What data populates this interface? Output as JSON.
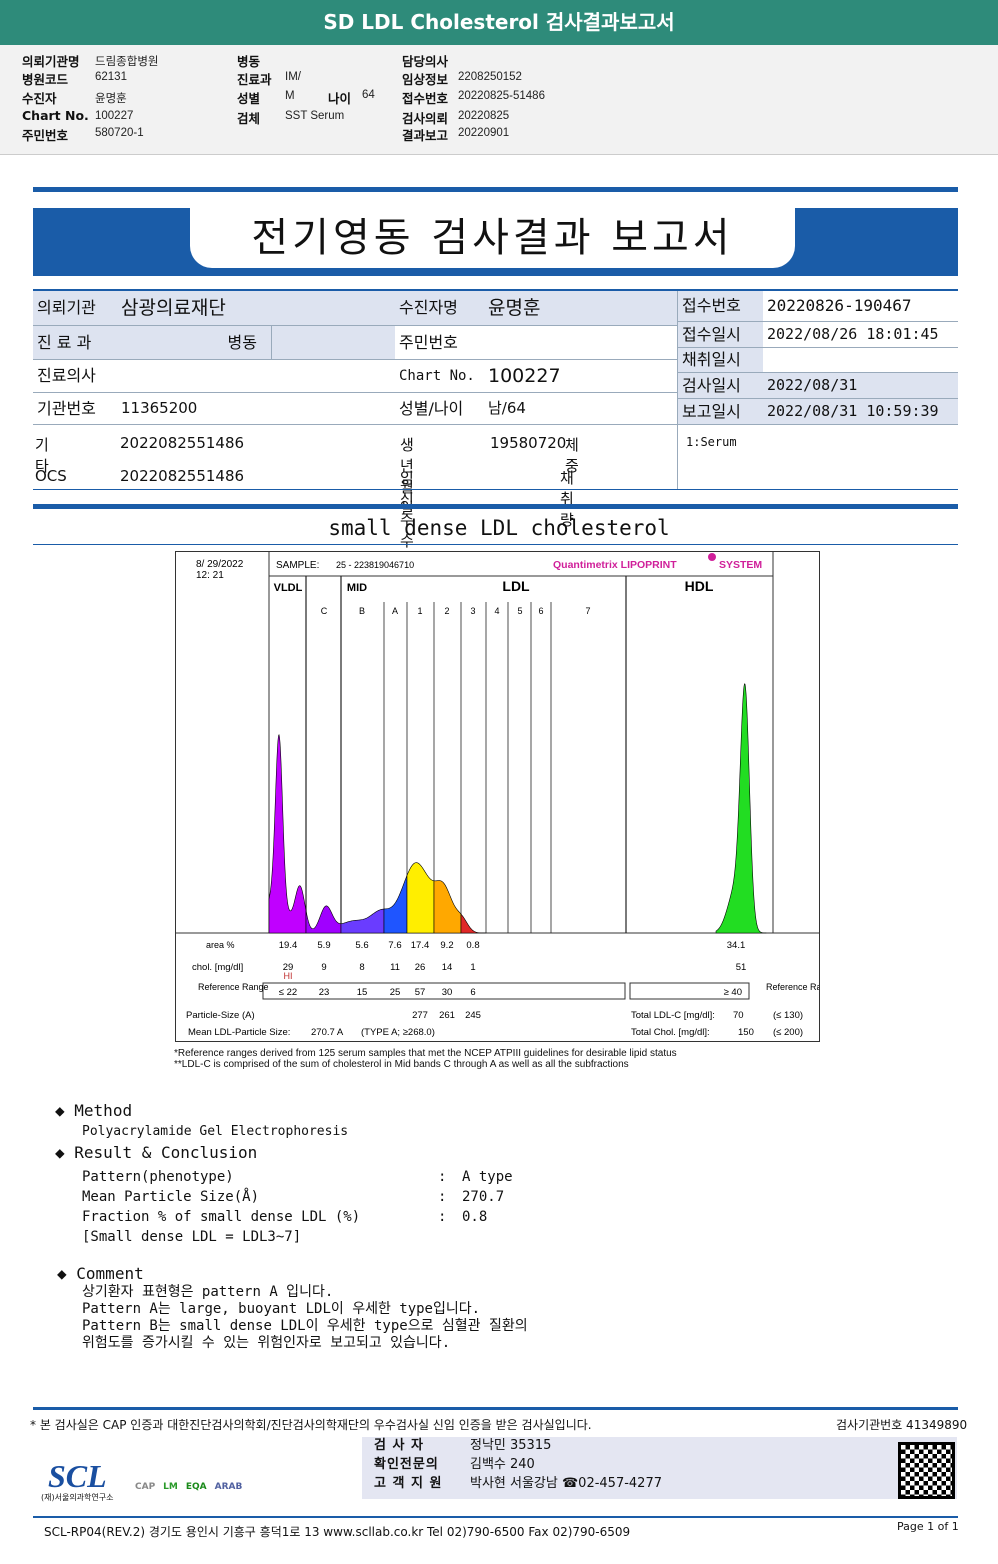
{
  "title": "SD LDL Cholesterol 검사결과보고서",
  "info": {
    "c1": [
      [
        "의뢰기관명",
        "드림종합병원"
      ],
      [
        "병원코드",
        "62131"
      ],
      [
        "수진자",
        "윤명훈"
      ],
      [
        "Chart No.",
        "100227"
      ],
      [
        "주민번호",
        "580720-1"
      ]
    ],
    "c2": [
      [
        "병동",
        ""
      ],
      [
        "진료과",
        "IM/"
      ],
      [
        "성별",
        "M"
      ],
      [
        "검체",
        "SST Serum"
      ]
    ],
    "age_label": "나이",
    "age": "64",
    "c3": [
      [
        "담당의사",
        ""
      ],
      [
        "임상정보",
        "2208250152"
      ],
      [
        "접수번호",
        "20220825-51486"
      ],
      [
        "검사의뢰",
        "20220825"
      ],
      [
        "결과보고",
        "20220901"
      ]
    ]
  },
  "report_title": "전기영동 검사결과 보고서",
  "form": {
    "inst_l": "의뢰기관",
    "inst_v": "삼광의료재단",
    "patient_l": "수진자명",
    "patient_v": "윤명훈",
    "dept_l": "진 료 과",
    "ward_l": "병동",
    "rrn_l": "주민번호",
    "doctor_l": "진료의사",
    "chart_l": "Chart No.",
    "chart_v": "100227",
    "code_l": "기관번호",
    "code_v": "11365200",
    "sexage_l": "성별/나이",
    "sexage_v": "남/64",
    "etc_l": "기타",
    "etc_v": "2022082551486",
    "birth_l": "생년월일",
    "birth_v": "19580720",
    "weight_l": "체중",
    "ocs_l": "OCS",
    "ocs_v": "2022082551486",
    "preg_l": "임신주수",
    "vol_l": "채취량",
    "recno_l": "접수번호",
    "recno_v": "20220826-190467",
    "recdt_l": "접수일시",
    "recdt_v": "2022/08/26 18:01:45",
    "coll_l": "채취일시",
    "test_l": "검사일시",
    "test_v": "2022/08/31",
    "rep_l": "보고일시",
    "rep_v": "2022/08/31 10:59:39",
    "specimen": "1:Serum"
  },
  "section_title": "small dense LDL cholesterol",
  "chart": {
    "date": "8/ 29/2022",
    "time": "12: 21",
    "sample_label": "SAMPLE:",
    "sample": "25 - 223819046710",
    "brand": "Quantimetrix LIPOPRINT",
    "brand2": "SYSTEM",
    "brand_color": "#d0209a",
    "groups": [
      "VLDL",
      "MID",
      "LDL",
      "HDL"
    ],
    "bands": [
      "C",
      "B",
      "A",
      "1",
      "2",
      "3",
      "4",
      "5",
      "6",
      "7"
    ],
    "row_area": "area %",
    "row_chol": "chol. [mg/dl]",
    "ref_label": "Reference Range",
    "ref_label_r": "Reference Range",
    "area": [
      "19.4",
      "5.9",
      "5.6",
      "7.6",
      "17.4",
      "9.2",
      "0.8"
    ],
    "area_hdl": "34.1",
    "chol": [
      "29",
      "9",
      "8",
      "11",
      "26",
      "14",
      "1"
    ],
    "chol_hdl": "51",
    "hi_flag": "HI",
    "ref": [
      "≤ 22",
      "23",
      "15",
      "25",
      "57",
      "30",
      "6"
    ],
    "ref_hdl": "≥ 40",
    "ps_label": "Particle-Size (A)",
    "ps": [
      "277",
      "261",
      "245"
    ],
    "mean_label": "Mean LDL-Particle Size:",
    "mean_v": "270.7 A",
    "mean_type": "(TYPE A; ≥268.0)",
    "tldl_label": "Total LDL-C [mg/dl]:",
    "tldl_v": "70",
    "tldl_ref": "(≤ 130)",
    "tchol_label": "Total Chol. [mg/dl]:",
    "tchol_v": "150",
    "tchol_ref": "(≤ 200)",
    "foot1": "*Reference ranges derived from 125 serum samples that met the NCEP ATPIII guidelines for desirable lipid status",
    "foot2": "**LDL-C is comprised of the sum of cholesterol in Mid bands C through A as well as all the subfractions"
  },
  "method": {
    "title": "Method",
    "text": "Polyacrylamide Gel Electrophoresis"
  },
  "result": {
    "title": "Result & Conclusion",
    "rows": [
      [
        "Pattern(phenotype)",
        ":",
        "A type"
      ],
      [
        "Mean Particle Size(Å)",
        ":",
        "270.7"
      ],
      [
        "Fraction % of small dense LDL (%)",
        ":",
        "0.8"
      ]
    ],
    "note": "[Small dense LDL = LDL3~7]"
  },
  "comment": {
    "title": "Comment",
    "lines": [
      "상기환자 표현형은 pattern A 입니다.",
      "Pattern A는 large, buoyant LDL이 우세한 type입니다.",
      "Pattern B는 small dense LDL이 우세한 type으로 심혈관 질환의",
      "위험도를 증가시킬 수 있는 위험인자로 보고되고 있습니다."
    ]
  },
  "footer": {
    "cert": "* 본 검사실은 CAP 인증과 대한진단검사의학회/진단검사의학재단의 우수검사실 신임 인증을 받은 검사실입니다.",
    "lab_no": "검사기관번호 41349890",
    "sig": [
      [
        "검 사 자",
        "정낙민 35315"
      ],
      [
        "확인전문의",
        "김백수 240"
      ],
      [
        "고 객 지 원",
        "박사현 서울강남 ☎02-457-4277"
      ]
    ],
    "logo": "SCL",
    "logo_sub": "(재)서울의과학연구소",
    "cert_logos": [
      "CAP",
      "LM",
      "EQA",
      "ARAB"
    ],
    "address": "SCL-RP04(REV.2)  경기도 용인시 기흥구 흥덕1로 13  www.scllab.co.kr  Tel 02)790-6500  Fax 02)790-6509",
    "page": "Page 1 of 1"
  }
}
